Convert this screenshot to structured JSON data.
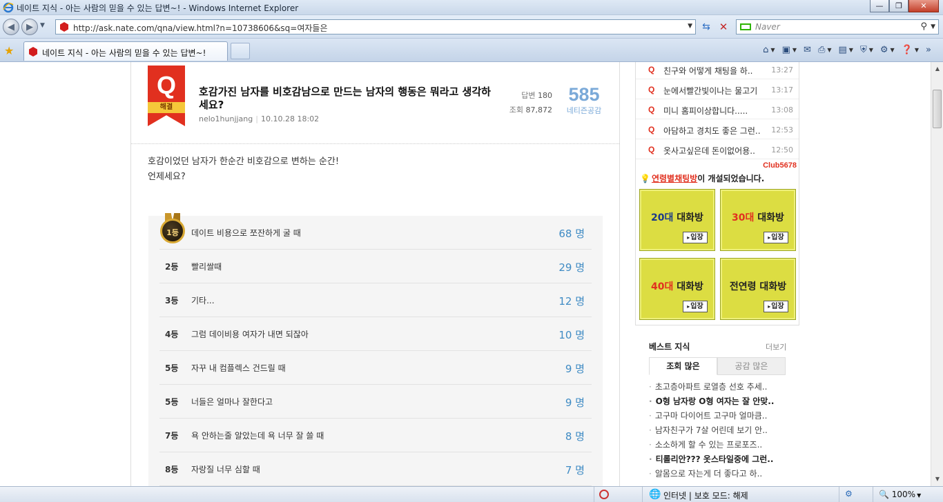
{
  "window": {
    "title": "네이트 지식 - 아는 사람의 믿을 수 있는 답변~! - Windows Internet Explorer",
    "url": "http://ask.nate.com/qna/view.html?n=10738606&sq=여자들은",
    "search_placeholder": "Naver",
    "tab_label": "네이트 지식 - 아는 사람의 믿을 수 있는 답변~!",
    "controls": {
      "minimize": "—",
      "maximize": "❐",
      "close": "✕"
    }
  },
  "question": {
    "badge_letter": "Q",
    "badge_status": "해결",
    "title": "호감가진 남자를 비호감남으로 만드는 남자의 행동은 뭐라고 생각하세요?",
    "author": "nelo1hunjjang",
    "date": "10.10.28 18:02",
    "answers_label": "답변",
    "answers_count": "180",
    "views_label": "조회",
    "views_count": "87,872",
    "empathy_count": "585",
    "empathy_label": "네티즌공감",
    "body_lines": [
      "호감이었던 남자가 한순간 비호감으로 변하는 순간!",
      "언제세요?"
    ]
  },
  "poll": {
    "rows": [
      {
        "rank": "1등",
        "option": "데이트 비용으로 쪼잔하게 굴 때",
        "count": "68 명"
      },
      {
        "rank": "2등",
        "option": "빨리쌀때",
        "count": "29 명"
      },
      {
        "rank": "3등",
        "option": "기타...",
        "count": "12 명"
      },
      {
        "rank": "4등",
        "option": "그럼 데이비용 여자가 내면 되잖아",
        "count": "10 명"
      },
      {
        "rank": "5등",
        "option": "자꾸 내 컴플렉스 건드릴 때",
        "count": "9 명"
      },
      {
        "rank": "5등",
        "option": "너들은 얼마나 잘한다고",
        "count": "9 명"
      },
      {
        "rank": "7등",
        "option": "욕 안하는줄 알았는데 욕 너무 잘 쓸 때",
        "count": "8 명"
      },
      {
        "rank": "8등",
        "option": "자랑질 너무 심할 때",
        "count": "7 명"
      }
    ]
  },
  "sidebar": {
    "chat_items": [
      {
        "text": "친구와 어떻게 채팅을 하..",
        "time": "13:27"
      },
      {
        "text": "눈에서빨간빛이나는 물고기",
        "time": "13:17"
      },
      {
        "text": "미니 홈피이상합니다.....",
        "time": "13:08"
      },
      {
        "text": "아담하고 경치도 좋은 그런..",
        "time": "12:53"
      },
      {
        "text": "옷사고싶은데 돈이없어용..",
        "time": "12:50"
      }
    ],
    "club_label": "Club5678",
    "notice_highlight": "연령별채팅방",
    "notice_rest": "이 개설되었습니다.",
    "rooms": [
      {
        "age": "20대",
        "suffix": " 대화방",
        "enter": "입장"
      },
      {
        "age": "30대",
        "suffix": " 대화방",
        "enter": "입장"
      },
      {
        "age": "40대",
        "suffix": " 대화방",
        "enter": "입장"
      },
      {
        "age": "전연령",
        "suffix": " 대화방",
        "enter": "입장"
      }
    ],
    "best": {
      "title": "베스트 지식",
      "more": "더보기",
      "tab_active": "조회 많은",
      "tab_inactive": "공감 많은",
      "items": [
        "초고층아파트 로열층 선호 추세..",
        "O형 남자랑 O형 여자는 잘 안맞..",
        "고구마 다이어트 고구마 얼마큼..",
        "남자친구가 7살 어린데 보기 안..",
        "소소하게 할 수 있는 프로포즈..",
        "티롤리안??? 옷스타일중에 그런..",
        "알몸으로 자는게 더 좋다고 하.."
      ]
    }
  },
  "status": {
    "zone": "인터넷 | 보호 모드: 해제",
    "zoom": "100%"
  }
}
